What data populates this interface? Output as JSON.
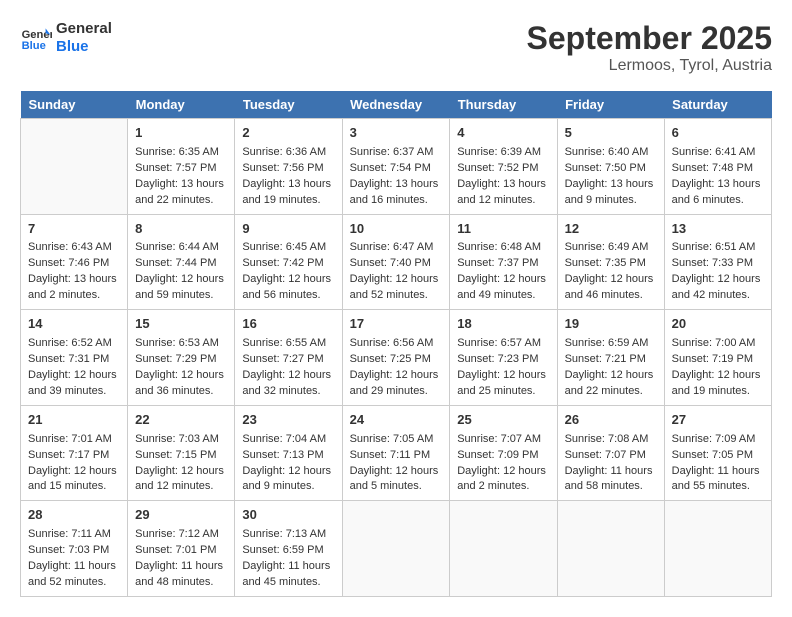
{
  "header": {
    "logo_line1": "General",
    "logo_line2": "Blue",
    "month": "September 2025",
    "location": "Lermoos, Tyrol, Austria"
  },
  "weekdays": [
    "Sunday",
    "Monday",
    "Tuesday",
    "Wednesday",
    "Thursday",
    "Friday",
    "Saturday"
  ],
  "weeks": [
    [
      {
        "day": "",
        "info": ""
      },
      {
        "day": "1",
        "info": "Sunrise: 6:35 AM\nSunset: 7:57 PM\nDaylight: 13 hours\nand 22 minutes."
      },
      {
        "day": "2",
        "info": "Sunrise: 6:36 AM\nSunset: 7:56 PM\nDaylight: 13 hours\nand 19 minutes."
      },
      {
        "day": "3",
        "info": "Sunrise: 6:37 AM\nSunset: 7:54 PM\nDaylight: 13 hours\nand 16 minutes."
      },
      {
        "day": "4",
        "info": "Sunrise: 6:39 AM\nSunset: 7:52 PM\nDaylight: 13 hours\nand 12 minutes."
      },
      {
        "day": "5",
        "info": "Sunrise: 6:40 AM\nSunset: 7:50 PM\nDaylight: 13 hours\nand 9 minutes."
      },
      {
        "day": "6",
        "info": "Sunrise: 6:41 AM\nSunset: 7:48 PM\nDaylight: 13 hours\nand 6 minutes."
      }
    ],
    [
      {
        "day": "7",
        "info": "Sunrise: 6:43 AM\nSunset: 7:46 PM\nDaylight: 13 hours\nand 2 minutes."
      },
      {
        "day": "8",
        "info": "Sunrise: 6:44 AM\nSunset: 7:44 PM\nDaylight: 12 hours\nand 59 minutes."
      },
      {
        "day": "9",
        "info": "Sunrise: 6:45 AM\nSunset: 7:42 PM\nDaylight: 12 hours\nand 56 minutes."
      },
      {
        "day": "10",
        "info": "Sunrise: 6:47 AM\nSunset: 7:40 PM\nDaylight: 12 hours\nand 52 minutes."
      },
      {
        "day": "11",
        "info": "Sunrise: 6:48 AM\nSunset: 7:37 PM\nDaylight: 12 hours\nand 49 minutes."
      },
      {
        "day": "12",
        "info": "Sunrise: 6:49 AM\nSunset: 7:35 PM\nDaylight: 12 hours\nand 46 minutes."
      },
      {
        "day": "13",
        "info": "Sunrise: 6:51 AM\nSunset: 7:33 PM\nDaylight: 12 hours\nand 42 minutes."
      }
    ],
    [
      {
        "day": "14",
        "info": "Sunrise: 6:52 AM\nSunset: 7:31 PM\nDaylight: 12 hours\nand 39 minutes."
      },
      {
        "day": "15",
        "info": "Sunrise: 6:53 AM\nSunset: 7:29 PM\nDaylight: 12 hours\nand 36 minutes."
      },
      {
        "day": "16",
        "info": "Sunrise: 6:55 AM\nSunset: 7:27 PM\nDaylight: 12 hours\nand 32 minutes."
      },
      {
        "day": "17",
        "info": "Sunrise: 6:56 AM\nSunset: 7:25 PM\nDaylight: 12 hours\nand 29 minutes."
      },
      {
        "day": "18",
        "info": "Sunrise: 6:57 AM\nSunset: 7:23 PM\nDaylight: 12 hours\nand 25 minutes."
      },
      {
        "day": "19",
        "info": "Sunrise: 6:59 AM\nSunset: 7:21 PM\nDaylight: 12 hours\nand 22 minutes."
      },
      {
        "day": "20",
        "info": "Sunrise: 7:00 AM\nSunset: 7:19 PM\nDaylight: 12 hours\nand 19 minutes."
      }
    ],
    [
      {
        "day": "21",
        "info": "Sunrise: 7:01 AM\nSunset: 7:17 PM\nDaylight: 12 hours\nand 15 minutes."
      },
      {
        "day": "22",
        "info": "Sunrise: 7:03 AM\nSunset: 7:15 PM\nDaylight: 12 hours\nand 12 minutes."
      },
      {
        "day": "23",
        "info": "Sunrise: 7:04 AM\nSunset: 7:13 PM\nDaylight: 12 hours\nand 9 minutes."
      },
      {
        "day": "24",
        "info": "Sunrise: 7:05 AM\nSunset: 7:11 PM\nDaylight: 12 hours\nand 5 minutes."
      },
      {
        "day": "25",
        "info": "Sunrise: 7:07 AM\nSunset: 7:09 PM\nDaylight: 12 hours\nand 2 minutes."
      },
      {
        "day": "26",
        "info": "Sunrise: 7:08 AM\nSunset: 7:07 PM\nDaylight: 11 hours\nand 58 minutes."
      },
      {
        "day": "27",
        "info": "Sunrise: 7:09 AM\nSunset: 7:05 PM\nDaylight: 11 hours\nand 55 minutes."
      }
    ],
    [
      {
        "day": "28",
        "info": "Sunrise: 7:11 AM\nSunset: 7:03 PM\nDaylight: 11 hours\nand 52 minutes."
      },
      {
        "day": "29",
        "info": "Sunrise: 7:12 AM\nSunset: 7:01 PM\nDaylight: 11 hours\nand 48 minutes."
      },
      {
        "day": "30",
        "info": "Sunrise: 7:13 AM\nSunset: 6:59 PM\nDaylight: 11 hours\nand 45 minutes."
      },
      {
        "day": "",
        "info": ""
      },
      {
        "day": "",
        "info": ""
      },
      {
        "day": "",
        "info": ""
      },
      {
        "day": "",
        "info": ""
      }
    ]
  ]
}
